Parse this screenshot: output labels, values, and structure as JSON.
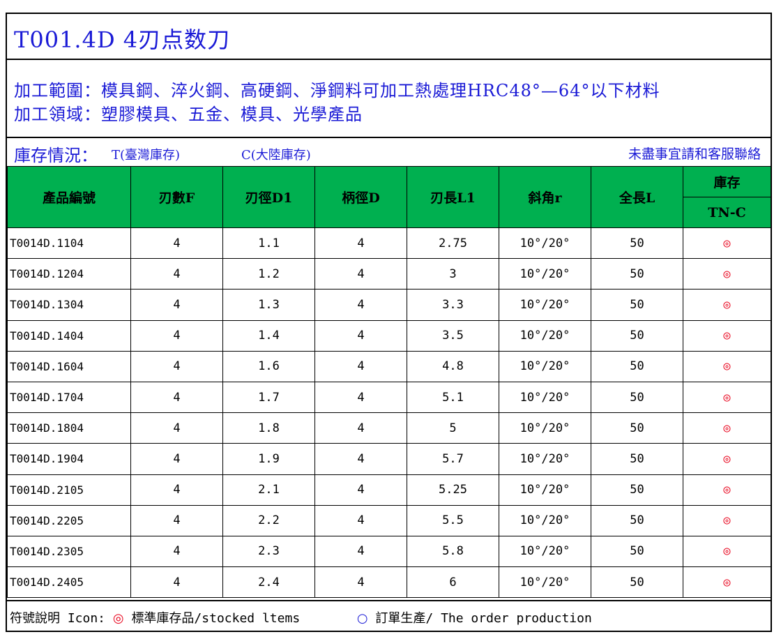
{
  "title": "T001.4D  4刃点数刀",
  "description": {
    "line1": "加工範圍：模具鋼、淬火鋼、高硬鋼、淨鋼料可加工熱處理HRC48°—64°以下材料",
    "line2": "加工領域：塑膠模具、五金、模具、光學產品"
  },
  "stock": {
    "label": "庫存情況：",
    "t": "T(臺灣庫存)",
    "c": "C(大陸庫存)",
    "contact": "未盡事宜請和客服聯絡"
  },
  "table": {
    "headers": [
      "產品編號",
      "刃數F",
      "刃徑D1",
      "柄徑D",
      "刃長L1",
      "斜角r",
      "全長L"
    ],
    "stock_header": "庫存",
    "stock_sub": "TN-C",
    "rows": [
      [
        "T0014D.1104",
        "4",
        "1.1",
        "4",
        "2.75",
        "10°/20°",
        "50",
        "◎"
      ],
      [
        "T0014D.1204",
        "4",
        "1.2",
        "4",
        "3",
        "10°/20°",
        "50",
        "◎"
      ],
      [
        "T0014D.1304",
        "4",
        "1.3",
        "4",
        "3.3",
        "10°/20°",
        "50",
        "◎"
      ],
      [
        "T0014D.1404",
        "4",
        "1.4",
        "4",
        "3.5",
        "10°/20°",
        "50",
        "◎"
      ],
      [
        "T0014D.1604",
        "4",
        "1.6",
        "4",
        "4.8",
        "10°/20°",
        "50",
        "◎"
      ],
      [
        "T0014D.1704",
        "4",
        "1.7",
        "4",
        "5.1",
        "10°/20°",
        "50",
        "◎"
      ],
      [
        "T0014D.1804",
        "4",
        "1.8",
        "4",
        "5",
        "10°/20°",
        "50",
        "◎"
      ],
      [
        "T0014D.1904",
        "4",
        "1.9",
        "4",
        "5.7",
        "10°/20°",
        "50",
        "◎"
      ],
      [
        "T0014D.2105",
        "4",
        "2.1",
        "4",
        "5.25",
        "10°/20°",
        "50",
        "◎"
      ],
      [
        "T0014D.2205",
        "4",
        "2.2",
        "4",
        "5.5",
        "10°/20°",
        "50",
        "◎"
      ],
      [
        "T0014D.2305",
        "4",
        "2.3",
        "4",
        "5.8",
        "10°/20°",
        "50",
        "◎"
      ],
      [
        "T0014D.2405",
        "4",
        "2.4",
        "4",
        "6",
        "10°/20°",
        "50",
        "◎"
      ]
    ]
  },
  "legend": {
    "label": "符號說明 Icon:",
    "stock_icon": "◎",
    "stock_text": "標準庫存品/stocked ltems",
    "order_icon": "○",
    "order_text": "訂單生產/ The order production"
  },
  "colors": {
    "title_blue": "#1a1ad6",
    "header_green": "#00b050",
    "stock_mark_red": "#e8001a"
  }
}
